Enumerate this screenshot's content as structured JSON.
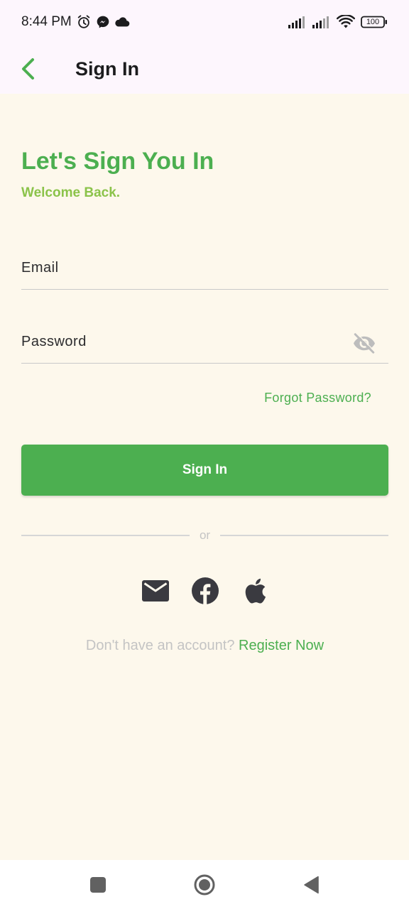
{
  "status_bar": {
    "time": "8:44 PM",
    "battery": "100",
    "icons": [
      "alarm-icon",
      "messenger-icon",
      "cloud-icon",
      "signal-icon",
      "signal-icon",
      "wifi-icon",
      "battery-icon"
    ]
  },
  "app_bar": {
    "title": "Sign In",
    "back_icon": "chevron-left-icon"
  },
  "main": {
    "headline": "Let's Sign You In",
    "subhead": "Welcome Back.",
    "email": {
      "placeholder": "Email",
      "value": ""
    },
    "password": {
      "placeholder": "Password",
      "value": "",
      "toggle_icon": "eye-off-icon"
    },
    "forgot_password": "Forgot Password?",
    "sign_in_button": "Sign In",
    "divider_text": "or",
    "social": [
      "mail-icon",
      "facebook-icon",
      "apple-icon"
    ],
    "register_prompt": "Don't have an account?",
    "register_link": "Register Now"
  },
  "nav_bar": {
    "icons": [
      "recents-square-icon",
      "home-circle-icon",
      "back-triangle-icon"
    ]
  },
  "colors": {
    "accent": "#4caf50",
    "subhead": "#8bc34a",
    "background": "#fdf8ec",
    "bar_background": "#fdf6fd",
    "muted_text": "#c4c4c4",
    "icon_dark": "#3a3a40"
  }
}
